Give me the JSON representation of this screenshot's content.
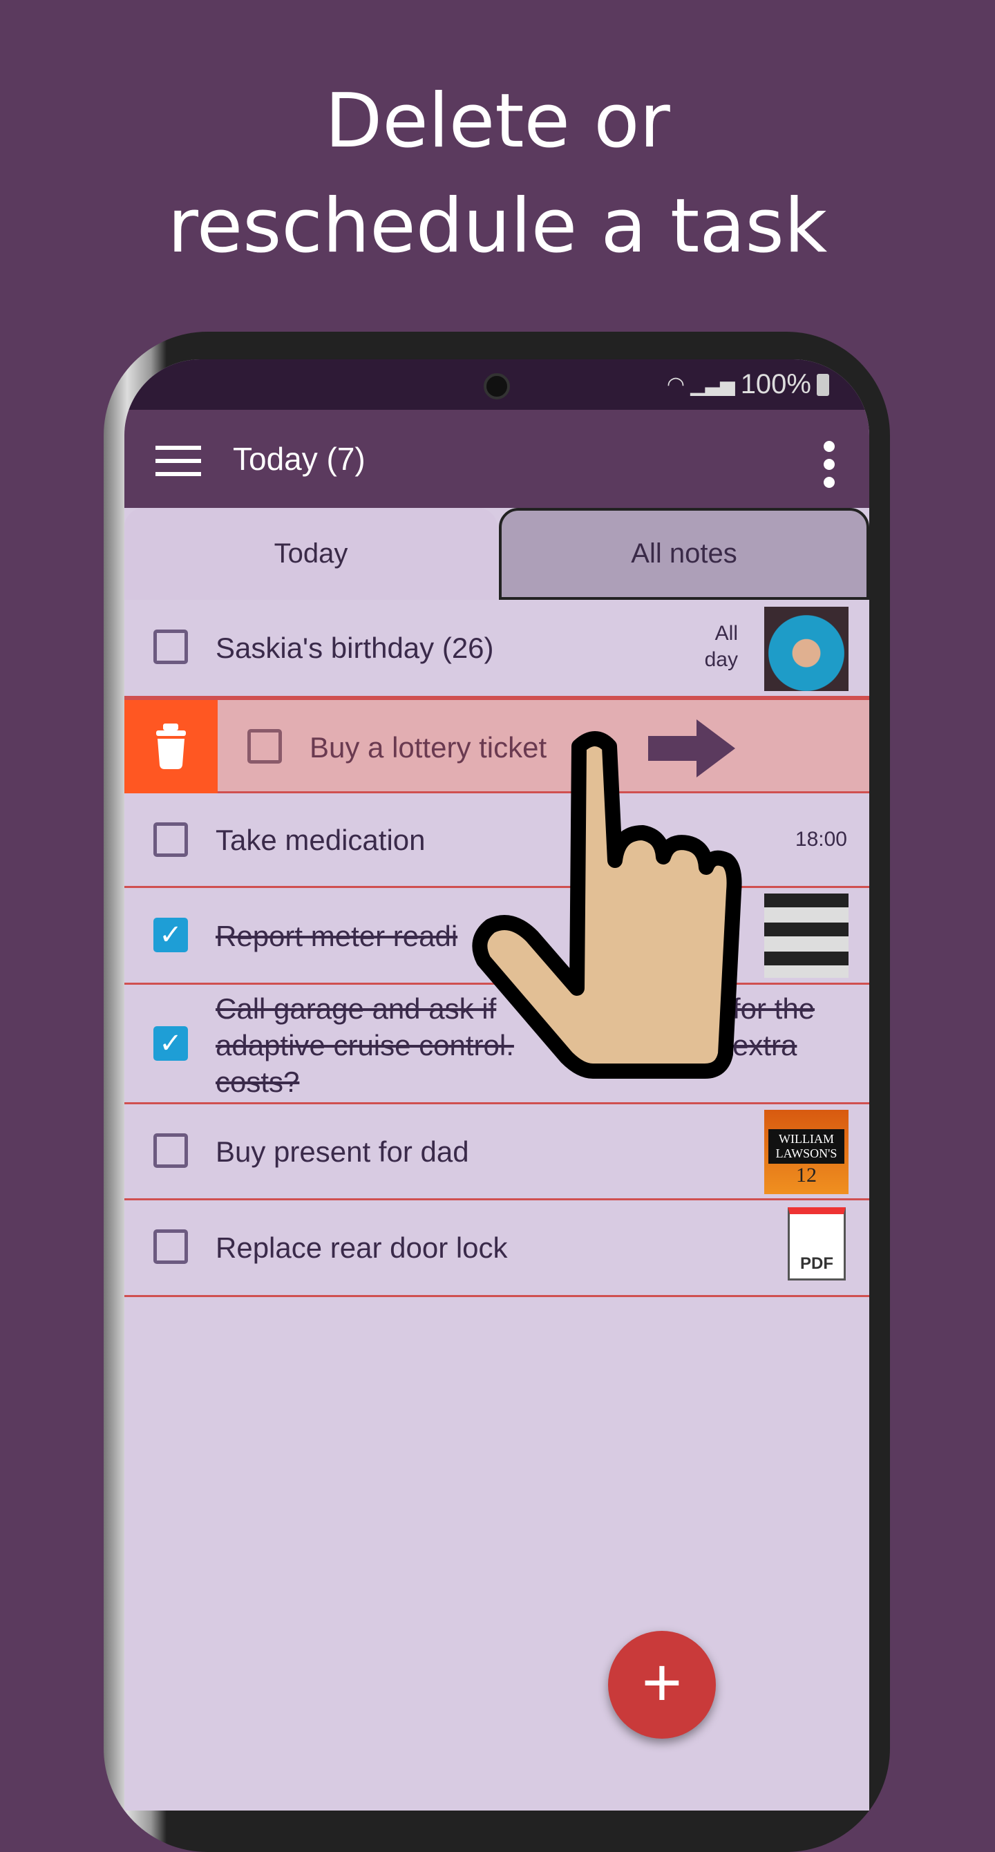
{
  "headline": {
    "line1": "Delete or",
    "line2": "reschedule a task"
  },
  "status_bar": {
    "battery": "100%",
    "icons": [
      "wifi-icon",
      "signal-icon",
      "battery-icon"
    ]
  },
  "app_bar": {
    "title": "Today (7)",
    "menu_icon": "hamburger-icon",
    "overflow_icon": "more-vert-icon"
  },
  "tabs": [
    {
      "label": "Today",
      "active": true
    },
    {
      "label": "All notes",
      "active": false
    }
  ],
  "tasks": [
    {
      "text": "Saskia's birthday (26)",
      "checked": false,
      "time_line1": "All",
      "time_line2": "day",
      "attachment": "photo"
    },
    {
      "text": "Buy a lottery ticket",
      "checked": false,
      "swiping": true,
      "delete_icon": "trash-icon",
      "reschedule_icon": "arrow-right-icon"
    },
    {
      "text": "Take medication",
      "checked": false,
      "time": "18:00"
    },
    {
      "text": "Report meter readi",
      "checked": true,
      "attachment": "meter-photo"
    },
    {
      "line1a": "Call garage and ask if",
      "line1b": "for the",
      "line2a": "adaptive cruise control.",
      "line2b": "extra",
      "line3": "costs?",
      "checked": true
    },
    {
      "text": "Buy present for dad",
      "checked": false,
      "attachment": "whisky-photo",
      "logo_text": "WILLIAM LAWSON'S",
      "logo_age": "12"
    },
    {
      "text": "Replace rear door lock",
      "checked": false,
      "attachment": "pdf",
      "pdf_label": "PDF"
    }
  ],
  "fab": {
    "label": "+",
    "icon": "add-icon"
  },
  "colors": {
    "background": "#5b3a5e",
    "list_bg": "#d8cbe2",
    "delete": "#ff5722",
    "divider": "#d05050",
    "fab": "#c93a3a",
    "check": "#1e9ed6"
  }
}
